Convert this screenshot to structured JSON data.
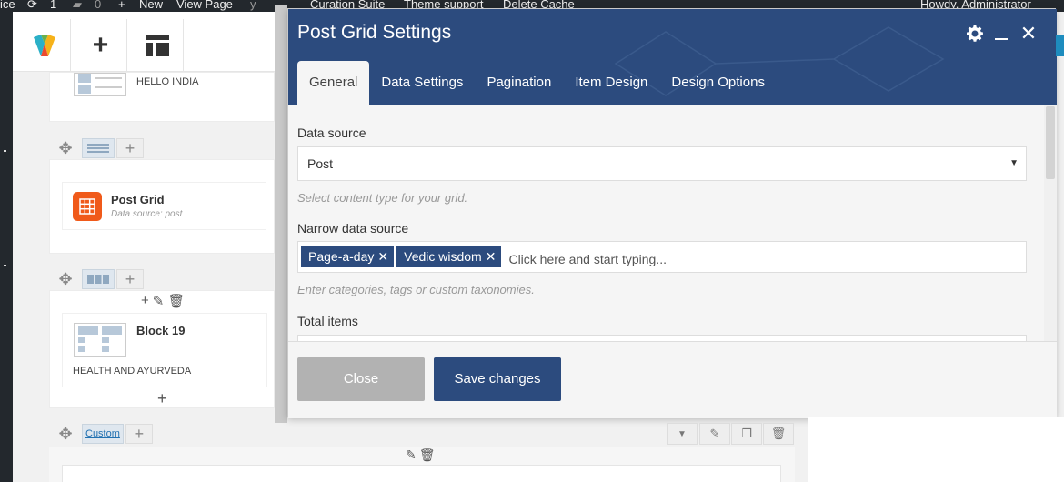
{
  "admin_bar": {
    "site_fragment": "ice",
    "updates_count": "1",
    "comments_count": "0",
    "new_label": "New",
    "view_page_label": "View Page",
    "curation_suite_label": "Curation Suite",
    "theme_support_label": "Theme support",
    "delete_cache_label": "Delete Cache",
    "howdy_label": "Howdy, Administrator"
  },
  "builder": {
    "row1": {
      "element_title": "HELLO INDIA"
    },
    "row2": {
      "element_title": "Post Grid",
      "element_subtitle": "Data source: post"
    },
    "row3": {
      "element_title": "Block 19",
      "element_subtitle": "HEALTH AND AYURVEDA"
    },
    "row4": {
      "custom_label": "Custom"
    }
  },
  "modal": {
    "title": "Post Grid Settings",
    "tabs": [
      {
        "label": "General",
        "active": true
      },
      {
        "label": "Data Settings",
        "active": false
      },
      {
        "label": "Pagination",
        "active": false
      },
      {
        "label": "Item Design",
        "active": false
      },
      {
        "label": "Design Options",
        "active": false
      }
    ],
    "fields": {
      "data_source": {
        "label": "Data source",
        "value": "Post",
        "help": "Select content type for your grid."
      },
      "narrow_source": {
        "label": "Narrow data source",
        "tags": [
          "Page-a-day",
          "Vedic wisdom"
        ],
        "placeholder": "Click here and start typing...",
        "help": "Enter categories, tags or custom taxonomies."
      },
      "total_items": {
        "label": "Total items"
      }
    },
    "buttons": {
      "close": "Close",
      "save": "Save changes"
    }
  },
  "colors": {
    "header": "#2c4b7e",
    "save_button": "#2c4b7e",
    "close_button": "#b2b2b2",
    "admin_bar": "#23282d",
    "post_grid_icon": "#f05a1a"
  },
  "icons": {
    "header": [
      "gear-icon",
      "minimize-icon",
      "close-icon"
    ],
    "row_controls": [
      "move-icon",
      "layout-icon",
      "add-icon"
    ],
    "element_controls": [
      "add-icon",
      "pencil-icon",
      "trash-icon"
    ]
  }
}
